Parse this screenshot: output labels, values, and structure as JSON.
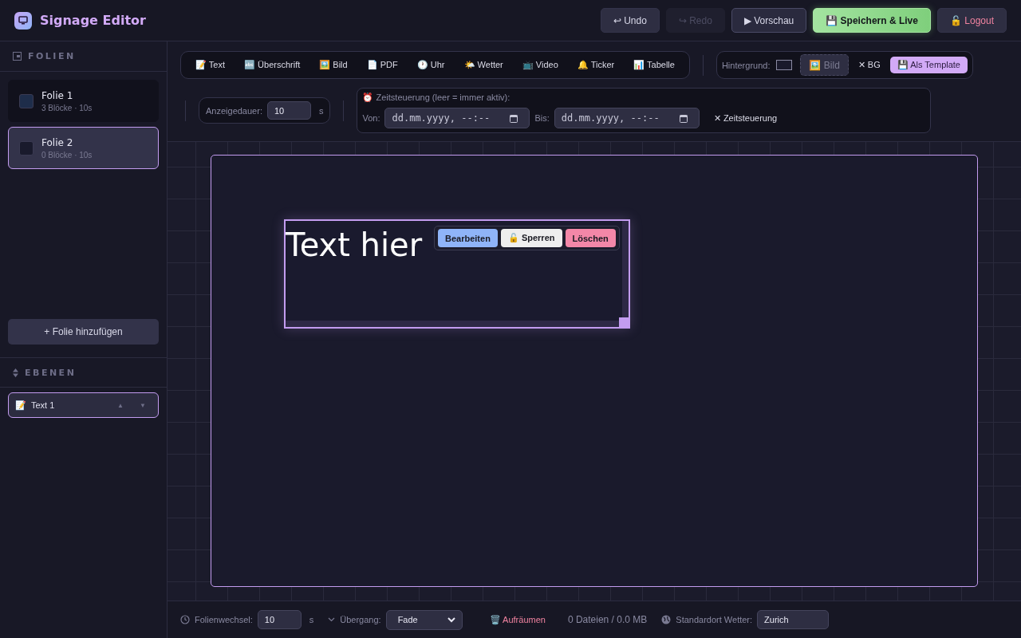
{
  "header": {
    "title": "Signage Editor",
    "buttons": [
      {
        "label": "↩ Undo",
        "kind": "default",
        "disabled": false
      },
      {
        "label": "↪ Redo",
        "kind": "default",
        "disabled": true
      },
      {
        "label": "▶ Vorschau",
        "kind": "outline",
        "disabled": false
      },
      {
        "label": "💾 Speichern & Live",
        "kind": "primary",
        "disabled": false
      },
      {
        "label": "🔓 Logout",
        "kind": "danger",
        "disabled": false
      }
    ]
  },
  "sidebar": {
    "slides_heading": "FOLIEN",
    "slides": [
      {
        "title": "Folie 1",
        "meta": "3 Blöcke · 10s",
        "color": "#1e2d4a",
        "selected": false
      },
      {
        "title": "Folie 2",
        "meta": "0 Blöcke · 10s",
        "color": "#191a2c",
        "selected": true
      }
    ],
    "add_button": "+ Folie hinzufügen",
    "layers_heading": "EBENEN",
    "layers": [
      {
        "icon": "📝",
        "label": "Text 1",
        "selected": true,
        "up": "▲",
        "down": "▼"
      }
    ]
  },
  "toolbar": {
    "blocks": [
      "📝 Text",
      "🔤 Überschrift",
      "🖼️ Bild",
      "📄 PDF",
      "🕐 Uhr",
      "🌤️ Wetter",
      "📺 Video",
      "🔔 Ticker",
      "📊 Tabelle"
    ],
    "background": {
      "label": "Hintergrund:",
      "image_button": "🖼️ Bild",
      "clear_button": "✕ BG",
      "template_button": "💾 Als Template"
    },
    "duration": {
      "label": "Anzeigedauer:",
      "value": "10",
      "unit": "s"
    },
    "schedule": {
      "label": "⏰ Zeitsteuerung (leer = immer aktiv):",
      "from_label": "Von:",
      "from_placeholder": "dd.mm.yyyy, --:--",
      "to_label": "Bis:",
      "to_placeholder": "dd.mm.yyyy, --:--",
      "clear_button": "✕ Zeitsteuerung"
    }
  },
  "canvas": {
    "block": {
      "text": "Text hier",
      "selected": true,
      "actions": [
        {
          "label": "Bearbeiten",
          "kind": "edit"
        },
        {
          "label": "🔓 Sperren",
          "kind": "lock"
        },
        {
          "label": "Löschen",
          "kind": "delete"
        }
      ]
    }
  },
  "footer": {
    "interval_label": "Folienwechsel:",
    "interval_value": "10",
    "interval_unit": "s",
    "transition_label": "Übergang:",
    "transition_value": "Fade",
    "cleanup_button": "🗑️ Aufräumen",
    "usage": "0 Dateien / 0.0 MB",
    "weather_label": "Standardort Wetter:",
    "weather_value": "Zurich"
  }
}
